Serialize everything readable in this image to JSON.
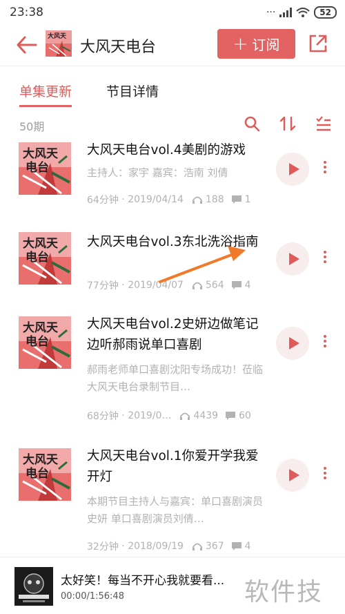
{
  "status": {
    "time": "23:38",
    "battery": "52"
  },
  "header": {
    "title": "大风天电台",
    "subscribe_label": "订阅"
  },
  "tabs": [
    {
      "label": "单集更新"
    },
    {
      "label": "节目详情"
    }
  ],
  "toolbar": {
    "count": "50期"
  },
  "episodes": [
    {
      "title": "大风天电台vol.4美剧的游戏",
      "desc": "主持人：家宇 嘉宾：浩南 刘倩",
      "duration": "64分钟",
      "date": "2019/04/14",
      "plays": "188",
      "comments": "1"
    },
    {
      "title": "大风天电台vol.3东北洗浴指南",
      "desc": "",
      "duration": "77分钟",
      "date": "2019/04/07",
      "plays": "564",
      "comments": "4"
    },
    {
      "title": "大风天电台vol.2史妍边做笔记边听郝雨说单口喜剧",
      "desc": "郝雨老师单口喜剧沈阳专场成功！莅临大风天电台录制节目…",
      "duration": "68分钟",
      "date": "2019/0…",
      "plays": "4439",
      "comments": "60"
    },
    {
      "title": "大风天电台vol.1你爱开学我爱开灯",
      "desc": "本期节目主持人与嘉宾：单口喜剧演员史妍 单口喜剧演员刘倩…",
      "duration": "32分钟",
      "date": "2018/09/19",
      "plays": "367",
      "comments": "4"
    }
  ],
  "miniplayer": {
    "title": "太好笑！每当不开心我就要看...",
    "time": "00:00/1:56:48"
  },
  "watermark": "软件技巧",
  "colors": {
    "accent": "#e36262",
    "muted": "#b2b2b2",
    "annotation_arrow": "#f07a2a"
  }
}
